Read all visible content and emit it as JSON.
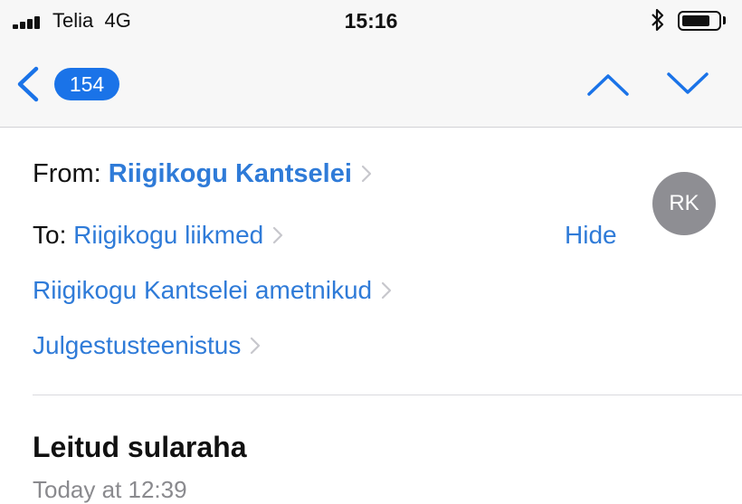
{
  "status_bar": {
    "carrier": "Telia",
    "network": "4G",
    "time": "15:16",
    "bluetooth_icon": "bluetooth-icon",
    "battery_icon": "battery-icon",
    "signal_icon": "signal-bars-icon"
  },
  "nav": {
    "back_icon": "chevron-left-icon",
    "unread_count": "154",
    "prev_icon": "chevron-up-icon",
    "next_icon": "chevron-down-icon",
    "accent_color": "#1a73e8"
  },
  "message": {
    "from_label": "From:",
    "from_name": "Riigikogu Kantselei",
    "to_label": "To:",
    "recipients": [
      "Riigikogu liikmed",
      "Riigikogu Kantselei ametnikud",
      "Julgestusteenistus"
    ],
    "hide_label": "Hide",
    "avatar_initials": "RK",
    "subject": "Leitud sularaha",
    "date": "Today at 12:39"
  }
}
